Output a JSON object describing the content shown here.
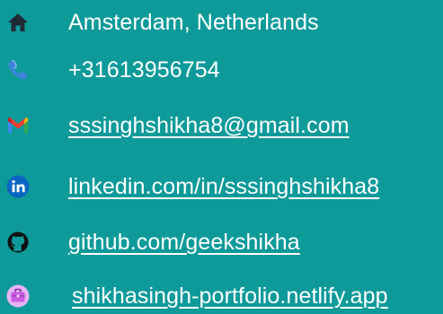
{
  "contact": {
    "location": {
      "icon": "home-icon",
      "text": "Amsterdam, Netherlands"
    },
    "phone": {
      "icon": "phone-icon",
      "text": "+31613956754"
    },
    "email": {
      "icon": "gmail-icon",
      "text": "sssinghshikha8@gmail.com"
    },
    "linkedin": {
      "icon": "linkedin-icon",
      "text": "linkedin.com/in/sssinghshikha8"
    },
    "github": {
      "icon": "github-icon",
      "text": "github.com/geekshikha"
    },
    "website": {
      "icon": "briefcase-icon",
      "text": "shikhasingh-portfolio.netlify.app"
    }
  },
  "colors": {
    "background": "#0f9a9a",
    "text": "#ffffff",
    "home": "#1f2a36",
    "phone": "#3b84d8",
    "gmail_red": "#ea4335",
    "gmail_blue": "#4285f4",
    "gmail_green": "#34a853",
    "gmail_yellow": "#fbbc04",
    "linkedin": "#0a66c2",
    "github": "#111111",
    "briefcase": "#c85be0"
  }
}
